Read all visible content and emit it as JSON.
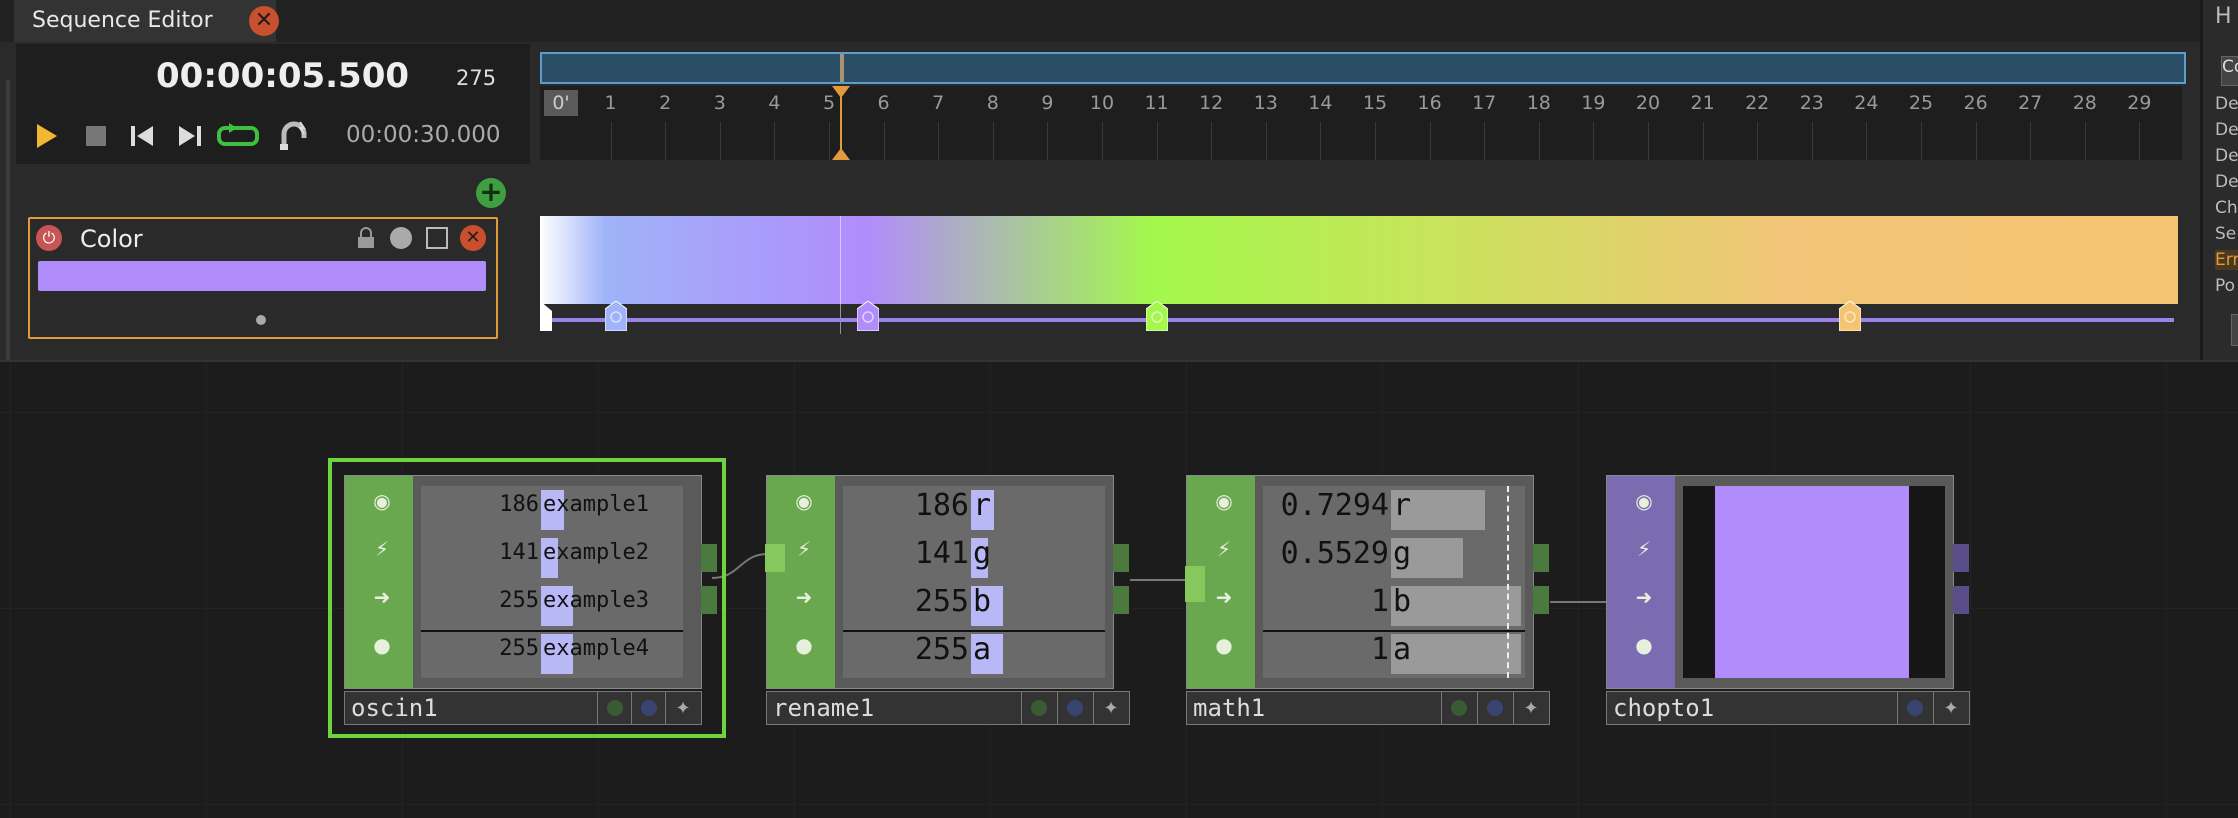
{
  "editor": {
    "tab_title": "Sequence Editor",
    "timecode": "00:00:05.500",
    "frame": "275",
    "duration": "00:00:30.000",
    "ruler_start": "0'",
    "ruler_labels": [
      "1",
      "2",
      "3",
      "4",
      "5",
      "6",
      "7",
      "8",
      "9",
      "10",
      "11",
      "12",
      "13",
      "14",
      "15",
      "16",
      "17",
      "18",
      "19",
      "20",
      "21",
      "22",
      "23",
      "24",
      "25",
      "26",
      "27",
      "28",
      "29"
    ],
    "playhead_seconds": 5.5,
    "total_seconds": 30,
    "track": {
      "title": "Color",
      "swatch_color": "#b18cfb"
    },
    "gradient_keys": [
      {
        "time": 0.0,
        "color": "#ffffff"
      },
      {
        "time": 1.4,
        "color": "#9fb3f8"
      },
      {
        "time": 6.0,
        "color": "#b18cfb"
      },
      {
        "time": 11.3,
        "color": "#a3f84b"
      },
      {
        "time": 24.0,
        "color": "#f5c472"
      }
    ],
    "accent": "#e39a3d"
  },
  "right_panel": {
    "lines": [
      "De",
      "De",
      "De",
      "De",
      "Ch",
      "Se",
      "Erro",
      "Po"
    ],
    "input_value": "Co",
    "header": "H"
  },
  "network": {
    "nodes": [
      {
        "name": "oscin1",
        "type_color": "#6aa84f",
        "selected": true,
        "channels": [
          {
            "value": "186",
            "name": "example1",
            "level": 0.73
          },
          {
            "value": "141",
            "name": "example2",
            "level": 0.55
          },
          {
            "value": "255",
            "name": "example3",
            "level": 1.0
          },
          {
            "value": "255",
            "name": "example4",
            "level": 1.0
          }
        ]
      },
      {
        "name": "rename1",
        "type_color": "#6aa84f",
        "selected": false,
        "channels": [
          {
            "value": "186",
            "name": "r",
            "level": 0.73
          },
          {
            "value": "141",
            "name": "g",
            "level": 0.55
          },
          {
            "value": "255",
            "name": "b",
            "level": 1.0
          },
          {
            "value": "255",
            "name": "a",
            "level": 1.0
          }
        ]
      },
      {
        "name": "math1",
        "type_color": "#6aa84f",
        "selected": false,
        "channels": [
          {
            "value": "0.7294",
            "name": "r",
            "level": 0.73
          },
          {
            "value": "0.5529",
            "name": "g",
            "level": 0.55
          },
          {
            "value": "1",
            "name": "b",
            "level": 1.0
          },
          {
            "value": "1",
            "name": "a",
            "level": 1.0
          }
        ]
      },
      {
        "name": "chopto1",
        "type_color": "#7b6bb0",
        "selected": false,
        "preview_color": "#b18cfb"
      }
    ]
  }
}
